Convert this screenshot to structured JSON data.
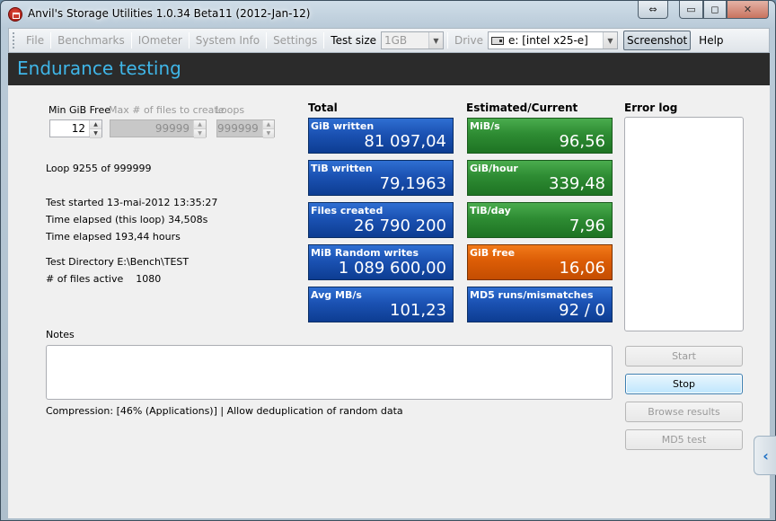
{
  "window": {
    "title": "Anvil's Storage Utilities 1.0.34 Beta11 (2012-Jan-12)",
    "controls": {
      "swap": "⇔",
      "minimize": "▭",
      "maximize": "◻",
      "close": "✕"
    }
  },
  "menu": {
    "file": "File",
    "benchmarks": "Benchmarks",
    "iometer": "IOmeter",
    "system_info": "System Info",
    "settings": "Settings",
    "test_size_label": "Test size",
    "test_size_value": "1GB",
    "drive_label": "Drive",
    "drive_value": "e: [intel x25-e]",
    "screenshot": "Screenshot",
    "help": "Help"
  },
  "header": {
    "title": "Endurance testing"
  },
  "params": {
    "min_gib_free_label": "Min GiB Free",
    "min_gib_free_value": "12",
    "max_files_label": "Max # of files to create",
    "max_files_value": "99999",
    "loops_label": "Loops",
    "loops_value": "999999"
  },
  "status": {
    "loop": "Loop 9255 of 999999",
    "test_started": "Test started 13-mai-2012 13:35:27",
    "time_elapsed_loop": "Time elapsed (this loop) 34,508s",
    "time_elapsed": "Time elapsed 193,44 hours",
    "test_directory": "Test Directory E:\\Bench\\TEST",
    "files_active": "# of files active    1080"
  },
  "total": {
    "title": "Total",
    "tiles": [
      {
        "label": "GiB written",
        "value": "81 097,04"
      },
      {
        "label": "TiB written",
        "value": "79,1963"
      },
      {
        "label": "Files created",
        "value": "26 790 200"
      },
      {
        "label": "MiB Random writes",
        "value": "1 089 600,00"
      },
      {
        "label": "Avg MB/s",
        "value": "101,23"
      }
    ]
  },
  "current": {
    "title": "Estimated/Current",
    "tiles": [
      {
        "label": "MiB/s",
        "value": "96,56"
      },
      {
        "label": "GiB/hour",
        "value": "339,48"
      },
      {
        "label": "TiB/day",
        "value": "7,96"
      },
      {
        "label": "GiB free",
        "value": "16,06"
      },
      {
        "label": "MD5 runs/mismatches",
        "value": "92 / 0"
      }
    ]
  },
  "error_log": {
    "title": "Error log"
  },
  "notes": {
    "label": "Notes"
  },
  "compression": "Compression: [46% (Applications)] | Allow deduplication of random data",
  "actions": {
    "start": "Start",
    "stop": "Stop",
    "browse": "Browse results",
    "md5": "MD5 test"
  },
  "colors": {
    "accent": "#3fb6e8",
    "tile_blue": "#1b52b3",
    "tile_green": "#2e8c33",
    "tile_orange": "#dc5d06"
  }
}
